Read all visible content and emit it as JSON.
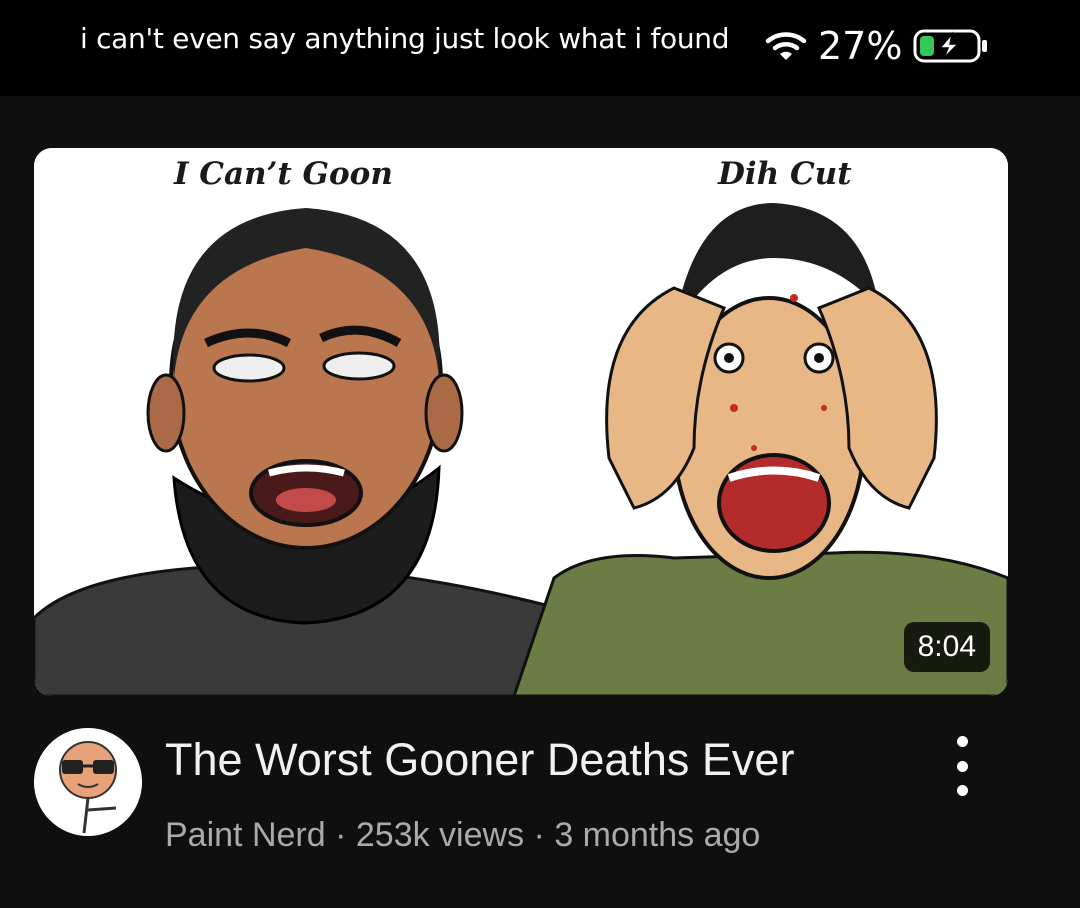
{
  "overlay": {
    "caption": "i can't even say anything just look what i found"
  },
  "status_bar": {
    "battery_percent": "27%",
    "wifi_icon": "wifi-icon",
    "battery_icon": "battery-charging-icon"
  },
  "video": {
    "thumbnail": {
      "left_label": "I Can’t Goon",
      "right_label": "Dih Cut"
    },
    "duration": "8:04",
    "title": "The Worst Gooner Deaths Ever",
    "channel": "Paint Nerd",
    "views": "253k views",
    "age": "3 months ago",
    "separator": "·",
    "more_icon": "more-vertical-icon"
  }
}
